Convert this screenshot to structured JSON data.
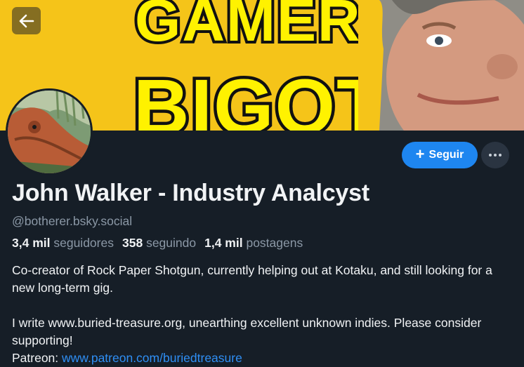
{
  "banner": {
    "line1": "GAMER",
    "line2": "BIGOTS"
  },
  "profile": {
    "display_name": "John Walker - Industry Analcyst",
    "handle": "@botherer.bsky.social",
    "follow_label": "Seguir"
  },
  "stats": {
    "followers_count": "3,4 mil",
    "followers_label": "seguidores",
    "following_count": "358",
    "following_label": "seguindo",
    "posts_count": "1,4 mil",
    "posts_label": "postagens"
  },
  "bio": {
    "para1": "Co-creator of Rock Paper Shotgun, currently helping out at Kotaku, and still looking for a new long-term gig.",
    "para2": "I write www.buried-treasure.org, unearthing excellent unknown indies. Please consider supporting!",
    "patreon_label": "Patreon:",
    "patreon_link": "www.patreon.com/buriedtreasure"
  },
  "colors": {
    "background": "#161e27",
    "accent": "#1e86f0",
    "banner_yellow": "#f5c419"
  },
  "icons": [
    "back-arrow-icon",
    "plus-icon",
    "more-dots-icon"
  ]
}
